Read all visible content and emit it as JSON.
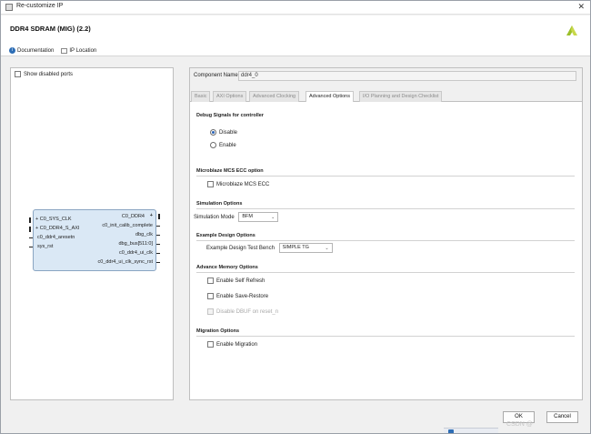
{
  "window": {
    "title": "Re-customize IP",
    "close_glyph": "✕"
  },
  "header": {
    "ip_name": "DDR4 SDRAM (MIG) (2.2)",
    "documentation_label": "Documentation",
    "ip_location_label": "IP Location"
  },
  "left_panel": {
    "show_disabled_ports": "Show disabled ports",
    "left_ports": [
      "C0_SYS_CLK",
      "C0_DDR4_S_AXI",
      "c0_ddr4_aresetn",
      "sys_rst"
    ],
    "right_ports": [
      "C0_DDR4",
      "c0_init_calib_complete",
      "dbg_clk",
      "dbg_bus[511:0]",
      "c0_ddr4_ui_clk",
      "c0_ddr4_ui_clk_sync_rst"
    ]
  },
  "component": {
    "label": "Component Name",
    "value": "ddr4_0"
  },
  "tabs": [
    {
      "label": "Basic"
    },
    {
      "label": "AXI Options"
    },
    {
      "label": "Advanced Clocking"
    },
    {
      "label": "Advanced Options"
    },
    {
      "label": "I/O Planning and Design Checklist"
    }
  ],
  "options": {
    "debug": {
      "title": "Debug Signals for controller",
      "disable": "Disable",
      "enable": "Enable"
    },
    "microblaze": {
      "title": "Microblaze MCS ECC option",
      "checkbox": "Microblaze MCS ECC"
    },
    "simulation": {
      "title": "Simulation Options",
      "mode_label": "Simulation Mode",
      "mode_value": "BFM"
    },
    "example": {
      "title": "Example Design Options",
      "bench_label": "Example Design Test Bench",
      "bench_value": "SIMPLE TG"
    },
    "memory": {
      "title": "Advance Memory Options",
      "self_refresh": "Enable Self Refresh",
      "save_restore": "Enable Save-Restore",
      "disable_dbuf": "Disable DBUF on reset_n"
    },
    "migration": {
      "title": "Migration Options",
      "checkbox": "Enable Migration"
    }
  },
  "buttons": {
    "ok": "OK",
    "cancel": "Cancel"
  },
  "watermark": "CSDN @"
}
